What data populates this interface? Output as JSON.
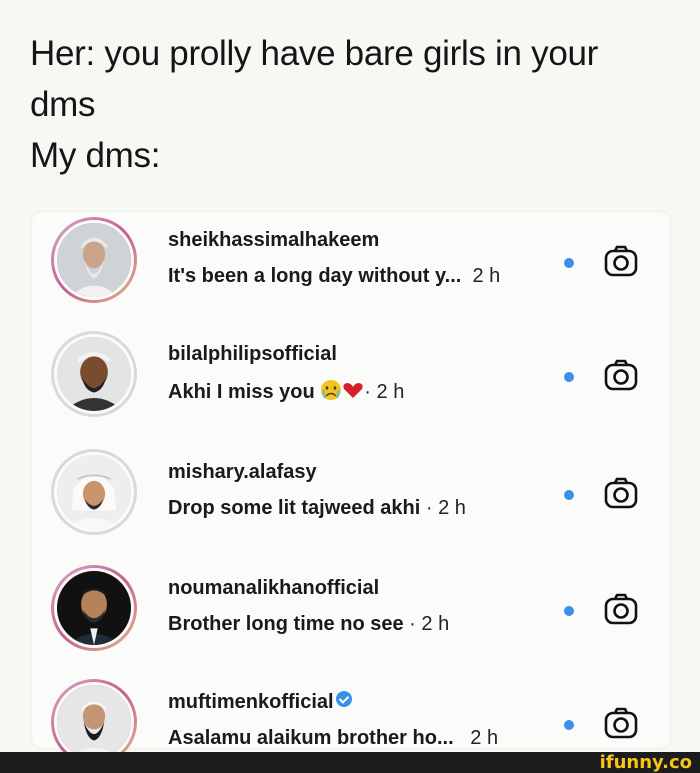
{
  "caption": {
    "line1": "Her: you prolly have bare girls in your",
    "line2": "dms",
    "line3": "My dms:"
  },
  "threads": [
    {
      "username": "sheikhassimalhakeem",
      "message": "It's been a long day without y...",
      "time": "2 h",
      "separator": "",
      "verified": false,
      "emoji": false,
      "unread": true,
      "avatar_ring": "gradient"
    },
    {
      "username": "bilalphilipsofficial",
      "message": "Akhi I miss you",
      "time": "2 h",
      "separator": "·",
      "verified": false,
      "emoji": true,
      "unread": true,
      "avatar_ring": "none"
    },
    {
      "username": "mishary.alafasy",
      "message": "Drop some lit tajweed akhi",
      "time": "2 h",
      "separator": "·",
      "verified": false,
      "emoji": false,
      "unread": true,
      "avatar_ring": "none"
    },
    {
      "username": "noumanalikhanofficial",
      "message": "Brother long time no see",
      "time": "2 h",
      "separator": "·",
      "verified": false,
      "emoji": false,
      "unread": true,
      "avatar_ring": "gradient"
    },
    {
      "username": "muftimenkofficial",
      "message": "Asalamu alaikum brother ho...",
      "time": "2 h",
      "separator": "",
      "verified": true,
      "emoji": false,
      "unread": true,
      "avatar_ring": "gradient"
    }
  ],
  "icons": {
    "camera": "camera-icon",
    "unread": "unread-dot-icon",
    "verified": "verified-badge-icon",
    "emoji": "crying-face-heart-emoji"
  },
  "colors": {
    "unread_dot": "#3a8fe6",
    "watermark": "#f5c518"
  },
  "watermark": "ifunny.co"
}
